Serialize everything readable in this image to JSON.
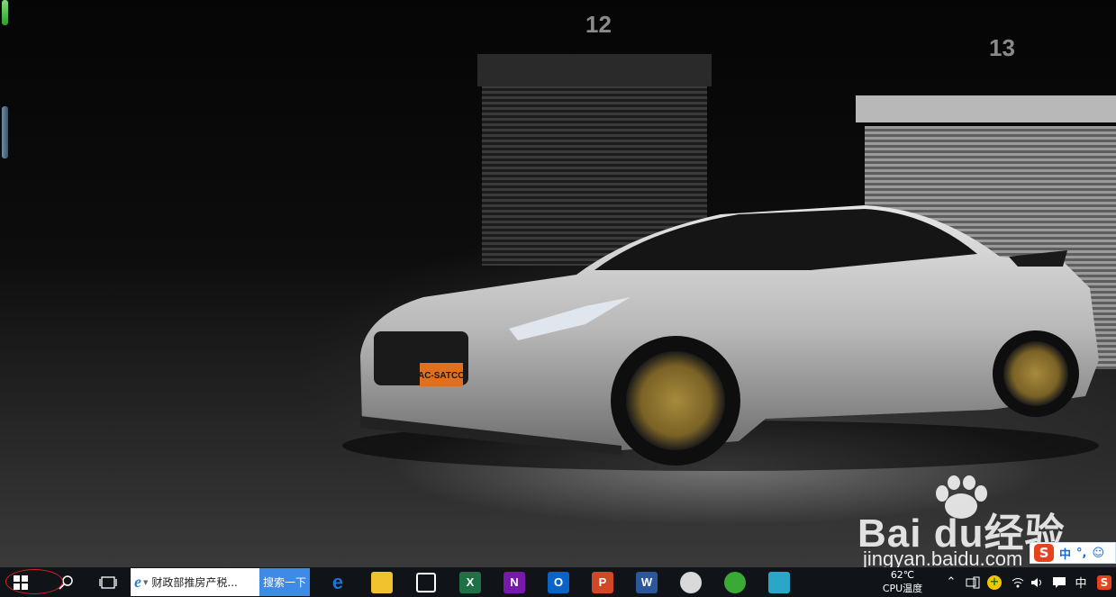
{
  "desktop": {
    "wallpaper": "Silver sports car in dark garage",
    "bay_left": "12",
    "bay_right": "13",
    "license_plate": "AC-SATCO"
  },
  "watermark": {
    "brand": "Bai du经验",
    "url": "jingyan.baidu.com"
  },
  "ime_bar": {
    "logo": "S",
    "mode": "中",
    "punct": "°,",
    "emoji_icon": "smiley-icon"
  },
  "taskbar": {
    "start_icon": "windows-logo-icon",
    "search_icon": "magnifier-icon",
    "task_view_icon": "task-view-icon",
    "search_box": {
      "icon": "ie-icon",
      "text": "财政部推房产税..."
    },
    "search_button": "搜索一下",
    "pinned": [
      {
        "name": "edge",
        "glyph": "e",
        "color": "#1e73d8"
      },
      {
        "name": "file-explorer",
        "glyph": "",
        "color": "#f2c12e"
      },
      {
        "name": "store",
        "glyph": "",
        "color": "#ffffff"
      },
      {
        "name": "excel",
        "glyph": "X",
        "color": "#1e7145"
      },
      {
        "name": "onenote",
        "glyph": "N",
        "color": "#7719aa"
      },
      {
        "name": "outlook",
        "glyph": "O",
        "color": "#0a64c8"
      },
      {
        "name": "powerpoint",
        "glyph": "P",
        "color": "#d24726"
      },
      {
        "name": "word",
        "glyph": "W",
        "color": "#2b579a"
      },
      {
        "name": "paint",
        "glyph": "",
        "color": "#d9d9d9"
      },
      {
        "name": "360-browser",
        "glyph": "",
        "color": "#3aa935"
      },
      {
        "name": "photo-viewer",
        "glyph": "",
        "color": "#2aa6c9"
      }
    ],
    "tray": {
      "cpu_temp_value": "62℃",
      "cpu_temp_label": "CPU温度",
      "input_mode": "中"
    }
  }
}
